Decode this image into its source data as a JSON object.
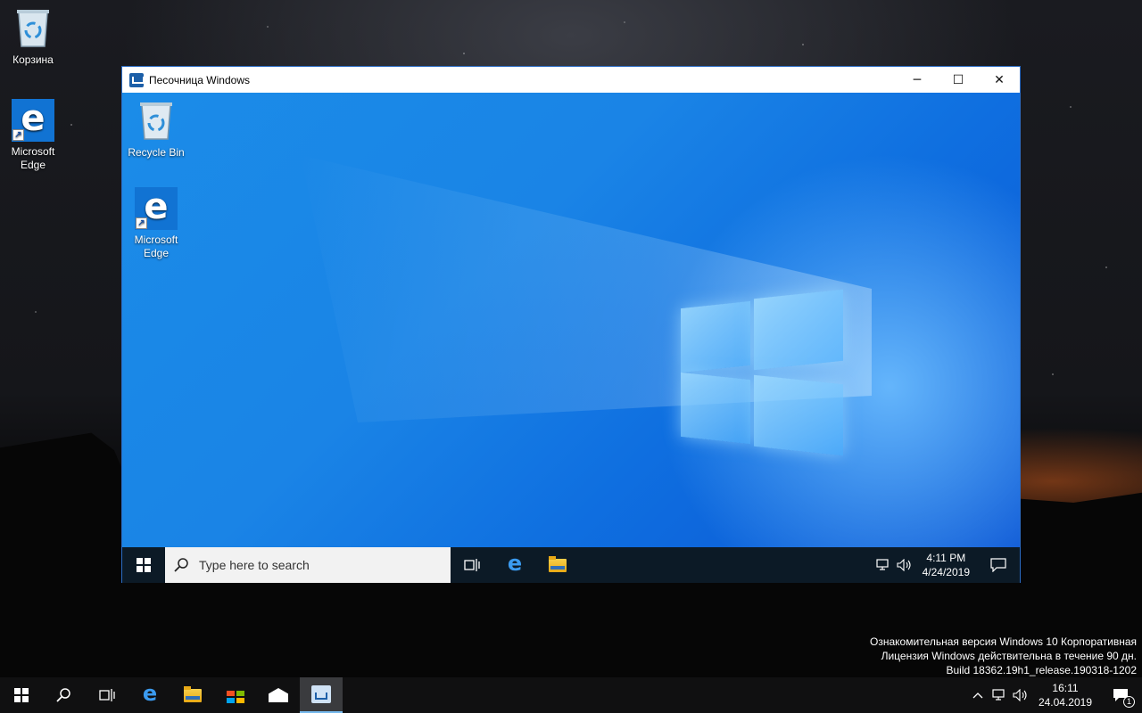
{
  "host_desktop": {
    "icons": [
      {
        "label": "Корзина",
        "icon": "recycle-bin-icon"
      },
      {
        "label": "Microsoft Edge",
        "icon": "edge-icon"
      }
    ]
  },
  "sandbox_window": {
    "title": "Песочница Windows",
    "controls": {
      "minimize": "─",
      "maximize": "☐",
      "close": "✕"
    },
    "desktop_icons": [
      {
        "label": "Recycle Bin",
        "icon": "recycle-bin-icon"
      },
      {
        "label": "Microsoft Edge",
        "icon": "edge-icon"
      }
    ],
    "taskbar": {
      "search_placeholder": "Type here to search",
      "clock_time": "4:11 PM",
      "clock_date": "4/24/2019"
    }
  },
  "watermark": {
    "line1": "Ознакомительная версия Windows 10 Корпоративная",
    "line2": "Лицензия Windows действительна в течение 90 дн.",
    "line3": "Build 18362.19h1_release.190318-1202"
  },
  "host_taskbar": {
    "clock_time": "16:11",
    "clock_date": "24.04.2019",
    "notification_count": "1"
  },
  "colors": {
    "accent": "#0078d7",
    "sandbox_border": "#2b6cc4",
    "edge_blue": "#1173d3"
  }
}
